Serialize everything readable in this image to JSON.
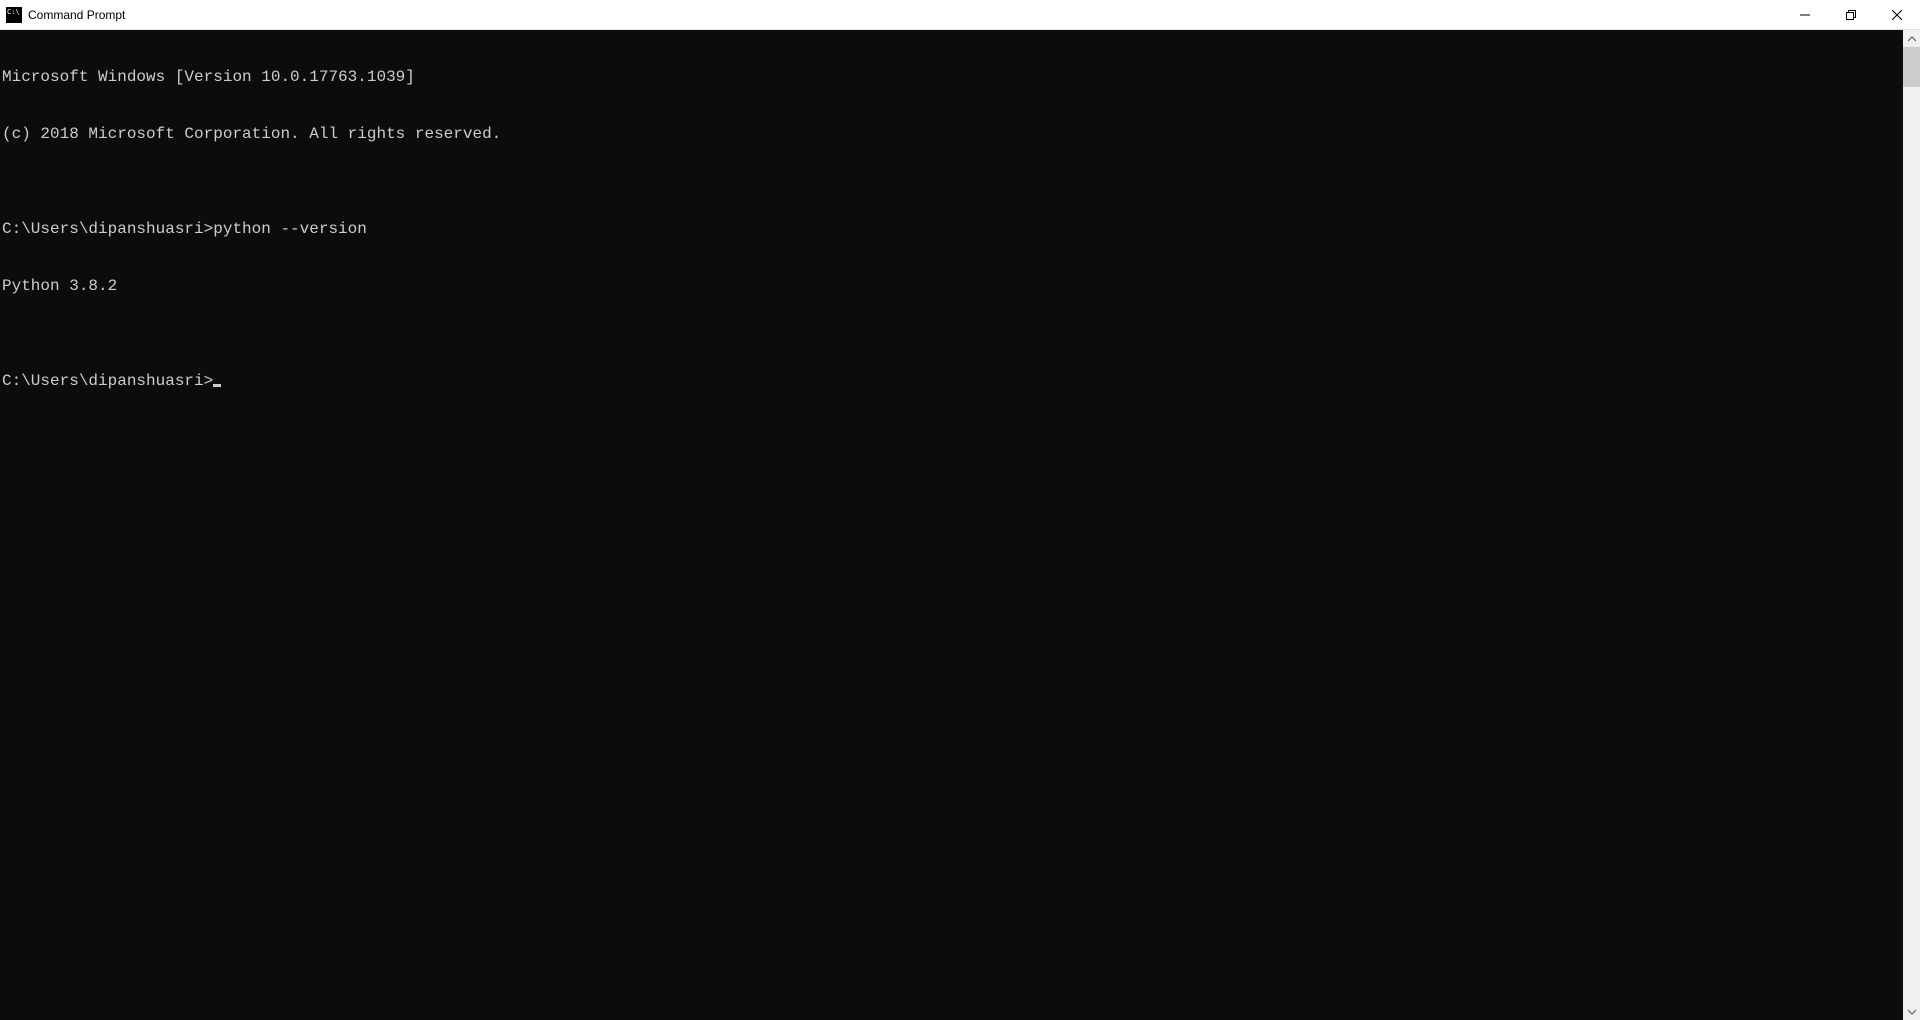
{
  "titlebar": {
    "app_title": "Command Prompt"
  },
  "terminal": {
    "lines": [
      "Microsoft Windows [Version 10.0.17763.1039]",
      "(c) 2018 Microsoft Corporation. All rights reserved.",
      "",
      "C:\\Users\\dipanshuasri>python --version",
      "Python 3.8.2",
      ""
    ],
    "current_prompt": "C:\\Users\\dipanshuasri>"
  }
}
